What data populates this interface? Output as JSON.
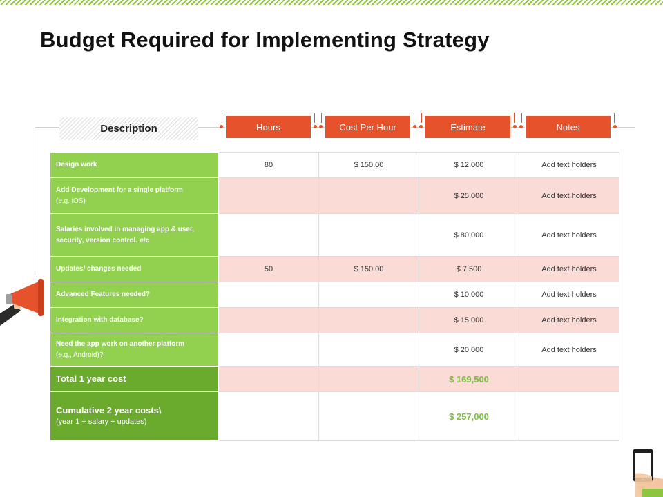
{
  "title": "Budget Required for Implementing Strategy",
  "table": {
    "headers": {
      "description": "Description",
      "hours": "Hours",
      "cost_per_hour": "Cost Per Hour",
      "estimate": "Estimate",
      "notes": "Notes"
    },
    "rows": [
      {
        "label": "Design work",
        "sub": "",
        "hours": "80",
        "cost": "$ 150.00",
        "estimate": "$ 12,000",
        "notes": "Add text holders"
      },
      {
        "label": "Add Development for a single platform",
        "sub": "(e.g. iOS)",
        "hours": "",
        "cost": "",
        "estimate": "$ 25,000",
        "notes": "Add text holders"
      },
      {
        "label": "Salaries involved in managing app & user, security, version control. etc",
        "sub": "",
        "hours": "",
        "cost": "",
        "estimate": "$ 80,000",
        "notes": "Add text holders"
      },
      {
        "label": "Updates/ changes needed",
        "sub": "",
        "hours": "50",
        "cost": "$ 150.00",
        "estimate": "$ 7,500",
        "notes": "Add text holders"
      },
      {
        "label": "Advanced Features needed?",
        "sub": "",
        "hours": "",
        "cost": "",
        "estimate": "$ 10,000",
        "notes": "Add text holders"
      },
      {
        "label": "Integration with database?",
        "sub": "",
        "hours": "",
        "cost": "",
        "estimate": "$ 15,000",
        "notes": "Add text holders"
      },
      {
        "label": "Need the app work on another platform",
        "sub": "(e.g., Android)?",
        "hours": "",
        "cost": "",
        "estimate": "$ 20,000",
        "notes": "Add text holders"
      },
      {
        "label": "Total 1 year cost",
        "sub": "",
        "hours": "",
        "cost": "",
        "estimate": "$ 169,500",
        "notes": ""
      },
      {
        "label": "Cumulative 2 year costs\\",
        "sub": "(year 1 + salary + updates)",
        "hours": "",
        "cost": "",
        "estimate": "$ 257,000",
        "notes": ""
      }
    ]
  },
  "colors": {
    "accent_orange": "#e6522c",
    "label_green": "#92d050",
    "total_green": "#6aaa2c",
    "row_pink": "#fadbd5"
  },
  "icons": [
    "megaphone-icon",
    "smartphone-icon"
  ]
}
